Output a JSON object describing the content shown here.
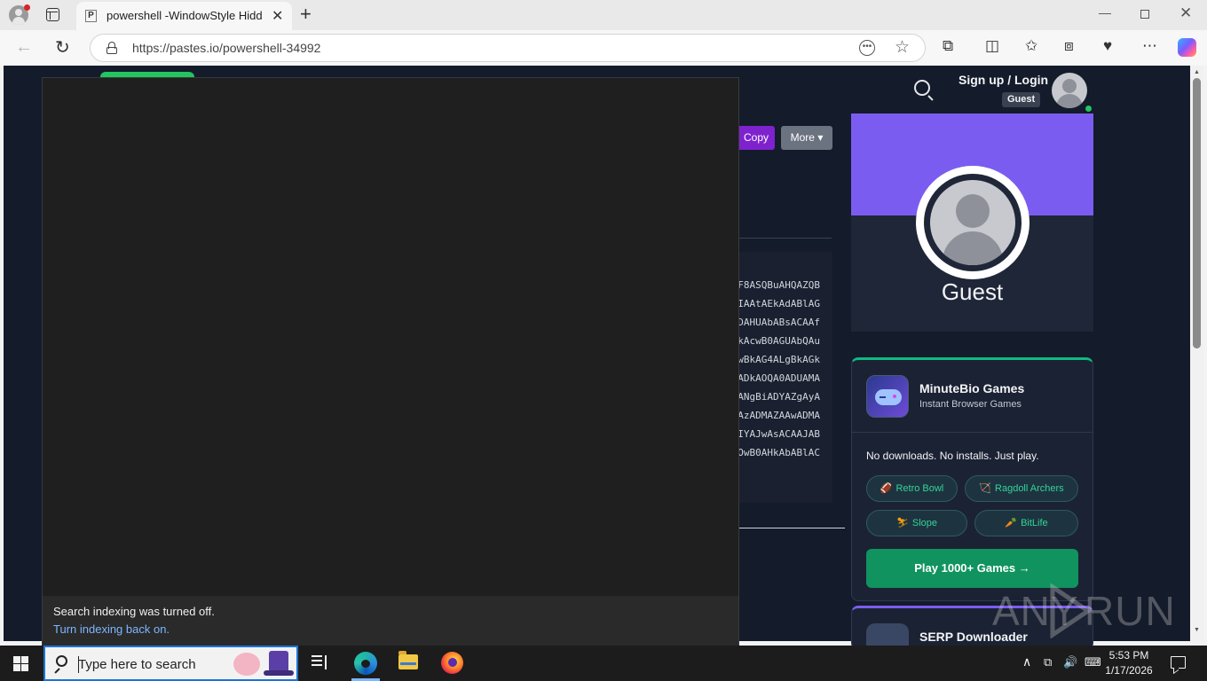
{
  "browser": {
    "tab_title": "powershell -WindowStyle Hidden",
    "tab_favicon": "P",
    "url": "https://pastes.io/powershell-34992",
    "icons": [
      "profile-icon",
      "tabs-icon",
      "close-icon",
      "plus-icon",
      "back-icon",
      "reload-icon",
      "lock-icon",
      "reader-icon",
      "star-icon",
      "extensions-icon",
      "split-icon",
      "favorites-icon",
      "collections-icon",
      "performance-icon",
      "more-icon",
      "copilot-icon"
    ]
  },
  "site": {
    "signup_label": "Sign up / Login",
    "guest_badge": "Guest",
    "copy_label": "Copy",
    "more_label": "More ▾",
    "code_lines": [
      "F8ASQBuAHQAZQB",
      "IAAtAEkAdABlAG",
      "DAHUAbABsACAAf",
      "kAcwB0AGUAbQAu",
      "wBkAG4ALgBkAGk",
      "ADkAOQA0ADUAMA",
      "ANgBiADYAZgAyA",
      "AzADMAZAAwADMA",
      "IYAJwAsACAAJAB",
      "OwB0AHkAbABlAC"
    ],
    "profile_name": "Guest",
    "games": {
      "title": "MinuteBio Games",
      "subtitle": "Instant Browser Games",
      "description": "No downloads. No installs. Just play.",
      "chips": [
        {
          "icon": "🏈",
          "label": "Retro Bowl"
        },
        {
          "icon": "🏹",
          "label": "Ragdoll Archers"
        },
        {
          "icon": "⛷",
          "label": "Slope"
        },
        {
          "icon": "🥕",
          "label": "BitLife"
        }
      ],
      "play_label": "Play 1000+ Games →"
    },
    "serp_title": "SERP Downloader"
  },
  "search_flyout": {
    "message": "Search indexing was turned off.",
    "link": "Turn indexing back on."
  },
  "watermark": {
    "left": "ANY",
    "right": "RUN"
  },
  "taskbar": {
    "search_placeholder": "Type here to search",
    "time": "5:53 PM",
    "date": "1/17/2026",
    "accent_color": "#7cb7ff"
  }
}
